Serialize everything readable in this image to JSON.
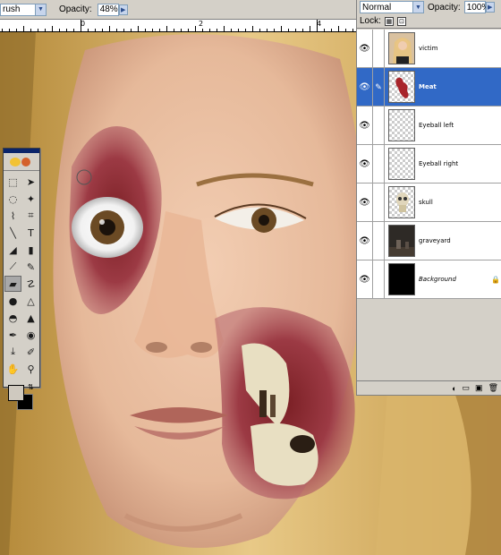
{
  "options_bar": {
    "brush_preset": "rush",
    "opacity_label": "Opacity:",
    "opacity_value": "48%"
  },
  "ruler": {
    "numbers": [
      "0",
      "2",
      "4"
    ]
  },
  "toolbox": {
    "tools": [
      "marquee-tool",
      "move-tool",
      "lasso-tool",
      "magic-wand-tool",
      "brush-selector-tool",
      "crop-tool",
      "slice-tool",
      "healing-tool",
      "line-tool",
      "type-tool",
      "fill-tool",
      "gradient-tool",
      "brush-tool",
      "pencil-tool",
      "eraser-tool",
      "smudge-tool",
      "dodge-tool",
      "burn-tool",
      "sponge-tool",
      "sharpen-tool",
      "pen-tool",
      "custom-shape-tool",
      "eyedropper-tool",
      "note-tool",
      "hand-tool",
      "zoom-tool"
    ],
    "foreground_color": "#cfc9bf",
    "background_color": "#000000"
  },
  "layers_panel": {
    "blend_mode": "Normal",
    "opacity_label": "Opacity:",
    "opacity_value": "100%",
    "lock_label": "Lock:",
    "layers": [
      {
        "name": "victim",
        "selected": false,
        "thumb": "photo"
      },
      {
        "name": "Meat",
        "selected": true,
        "thumb": "meat"
      },
      {
        "name": "Eyeball left",
        "selected": false,
        "thumb": "transparent"
      },
      {
        "name": "Eyeball right",
        "selected": false,
        "thumb": "transparent"
      },
      {
        "name": "skull",
        "selected": false,
        "thumb": "skull"
      },
      {
        "name": "graveyard",
        "selected": false,
        "thumb": "dark"
      },
      {
        "name": "Background",
        "selected": false,
        "thumb": "black"
      }
    ]
  },
  "colors": {
    "selection": "#3169c6",
    "panel_bg": "#d4d0c8"
  }
}
